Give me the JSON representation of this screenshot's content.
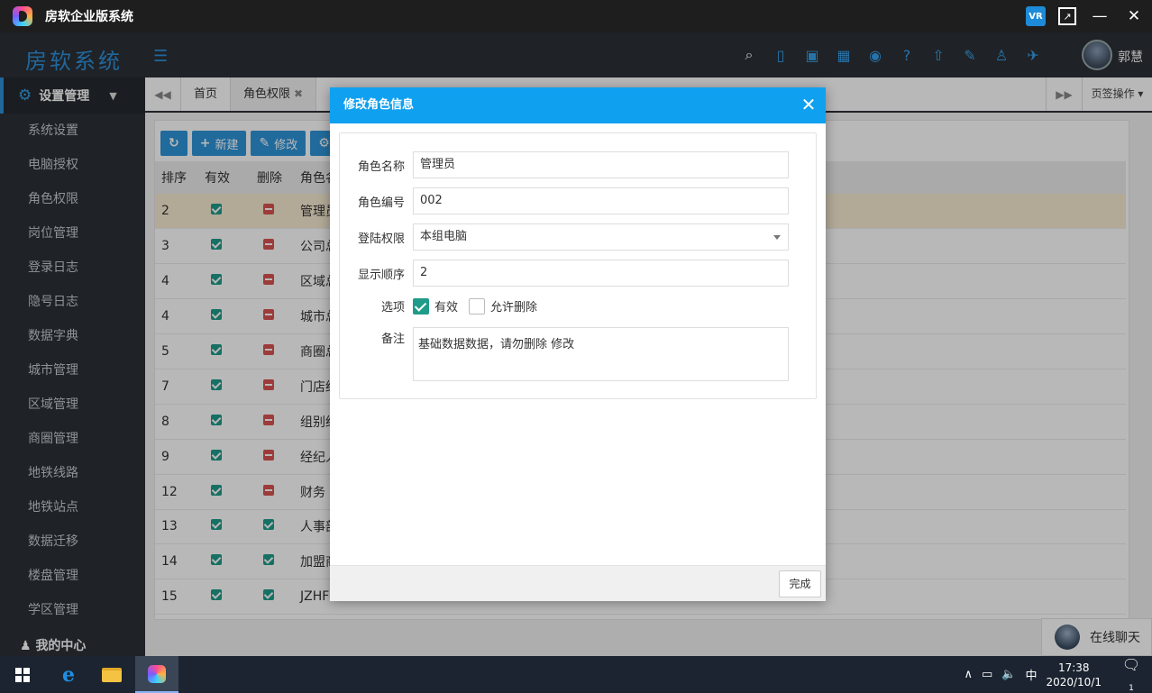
{
  "window": {
    "title": "房软企业版系统",
    "vr_label": "VR"
  },
  "header": {
    "brand": "房软系统",
    "username": "郭慧"
  },
  "sidebar": {
    "section": "设置管理",
    "items": [
      "系统设置",
      "电脑授权",
      "角色权限",
      "岗位管理",
      "登录日志",
      "隐号日志",
      "数据字典",
      "城市管理",
      "区域管理",
      "商圈管理",
      "地铁线路",
      "地铁站点",
      "数据迁移",
      "楼盘管理",
      "学区管理"
    ],
    "footer": "我的中心"
  },
  "tabs": {
    "home": "首页",
    "active": "角色权限",
    "ops": "页签操作"
  },
  "toolbar": {
    "new_label": "新建",
    "edit_label": "修改"
  },
  "grid": {
    "headers": [
      "排序",
      "有效",
      "删除",
      "角色名"
    ],
    "rows": [
      {
        "order": "2",
        "valid": true,
        "deletable": false,
        "name": "管理员"
      },
      {
        "order": "3",
        "valid": true,
        "deletable": false,
        "name": "公司总"
      },
      {
        "order": "4",
        "valid": true,
        "deletable": false,
        "name": "区域总"
      },
      {
        "order": "4",
        "valid": true,
        "deletable": false,
        "name": "城市总"
      },
      {
        "order": "5",
        "valid": true,
        "deletable": false,
        "name": "商圈总"
      },
      {
        "order": "7",
        "valid": true,
        "deletable": false,
        "name": "门店经"
      },
      {
        "order": "8",
        "valid": true,
        "deletable": false,
        "name": "组别经"
      },
      {
        "order": "9",
        "valid": true,
        "deletable": false,
        "name": "经纪人"
      },
      {
        "order": "12",
        "valid": true,
        "deletable": false,
        "name": "财务"
      },
      {
        "order": "13",
        "valid": true,
        "deletable": true,
        "name": "人事部"
      },
      {
        "order": "14",
        "valid": true,
        "deletable": true,
        "name": "加盟商"
      },
      {
        "order": "15",
        "valid": true,
        "deletable": true,
        "name": "JZHF"
      }
    ]
  },
  "chat": {
    "label": "在线聊天"
  },
  "modal": {
    "title": "修改角色信息",
    "fields": {
      "role_name_label": "角色名称",
      "role_name": "管理员",
      "role_code_label": "角色编号",
      "role_code": "002",
      "login_label": "登陆权限",
      "login_value": "本组电脑",
      "order_label": "显示顺序",
      "order_value": "2",
      "options_label": "选项",
      "opt_valid": "有效",
      "opt_delete": "允许删除",
      "remark_label": "备注",
      "remark": "基础数据数据，请勿删除 修改"
    },
    "done": "完成"
  },
  "taskbar": {
    "ime": "中",
    "time": "17:38",
    "date": "2020/10/1",
    "notifications": "1"
  }
}
